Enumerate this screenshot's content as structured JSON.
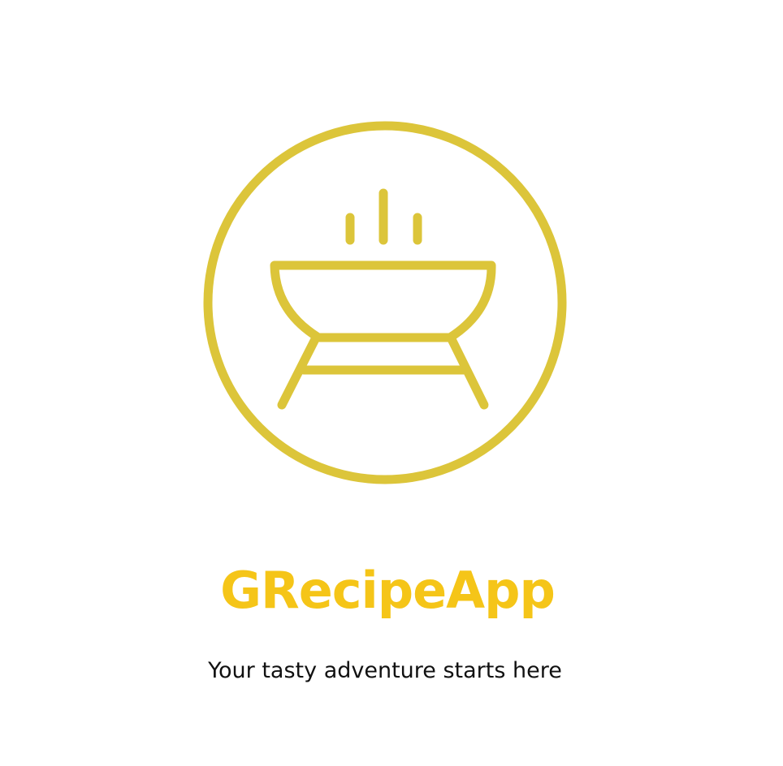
{
  "app": {
    "name": "GRecipeApp",
    "tagline": "Your tasty adventure starts here"
  },
  "logo": {
    "icon": "grill-bowl-icon",
    "ring_color": "#dcc53a",
    "name_color": "#f5c518",
    "text_color": "#111111"
  }
}
